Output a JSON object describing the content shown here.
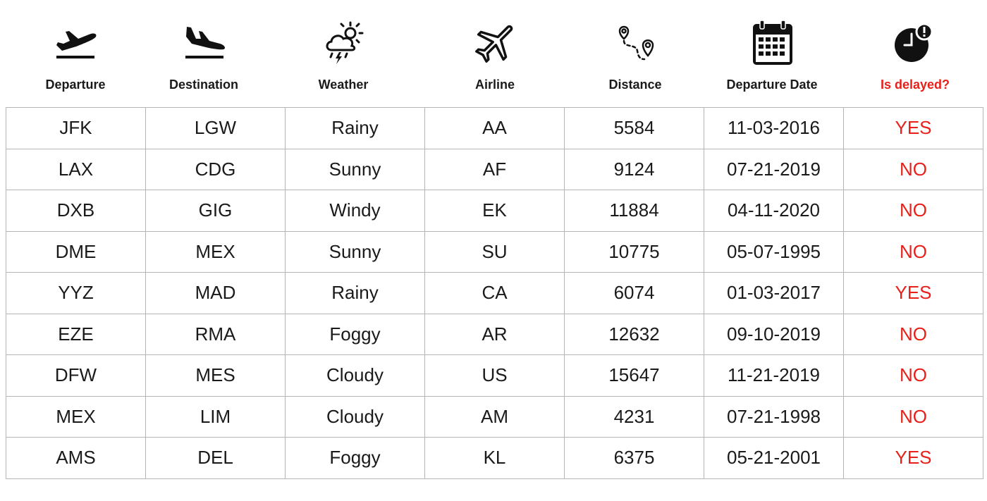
{
  "colors": {
    "text": "#1a1a1a",
    "accent_red": "#e8201a",
    "grid_line": "#b5b5b5"
  },
  "columns": [
    {
      "label": "Departure",
      "icon": "plane-takeoff-icon"
    },
    {
      "label": "Destination",
      "icon": "plane-landing-icon"
    },
    {
      "label": "Weather",
      "icon": "storm-cloud-sun-icon"
    },
    {
      "label": "Airline",
      "icon": "airplane-icon"
    },
    {
      "label": "Distance",
      "icon": "route-pins-icon"
    },
    {
      "label": "Departure Date",
      "icon": "calendar-icon"
    },
    {
      "label": "Is delayed?",
      "icon": "clock-alert-icon"
    }
  ],
  "rows": [
    [
      "JFK",
      "LGW",
      "Rainy",
      "AA",
      "5584",
      "11-03-2016",
      "YES"
    ],
    [
      "LAX",
      "CDG",
      "Sunny",
      "AF",
      "9124",
      "07-21-2019",
      "NO"
    ],
    [
      "DXB",
      "GIG",
      "Windy",
      "EK",
      "11884",
      "04-11-2020",
      "NO"
    ],
    [
      "DME",
      "MEX",
      "Sunny",
      "SU",
      "10775",
      "05-07-1995",
      "NO"
    ],
    [
      "YYZ",
      "MAD",
      "Rainy",
      "CA",
      "6074",
      "01-03-2017",
      "YES"
    ],
    [
      "EZE",
      "RMA",
      "Foggy",
      "AR",
      "12632",
      "09-10-2019",
      "NO"
    ],
    [
      "DFW",
      "MES",
      "Cloudy",
      "US",
      "15647",
      "11-21-2019",
      "NO"
    ],
    [
      "MEX",
      "LIM",
      "Cloudy",
      "AM",
      "4231",
      "07-21-1998",
      "NO"
    ],
    [
      "AMS",
      "DEL",
      "Foggy",
      "KL",
      "6375",
      "05-21-2001",
      "YES"
    ]
  ]
}
